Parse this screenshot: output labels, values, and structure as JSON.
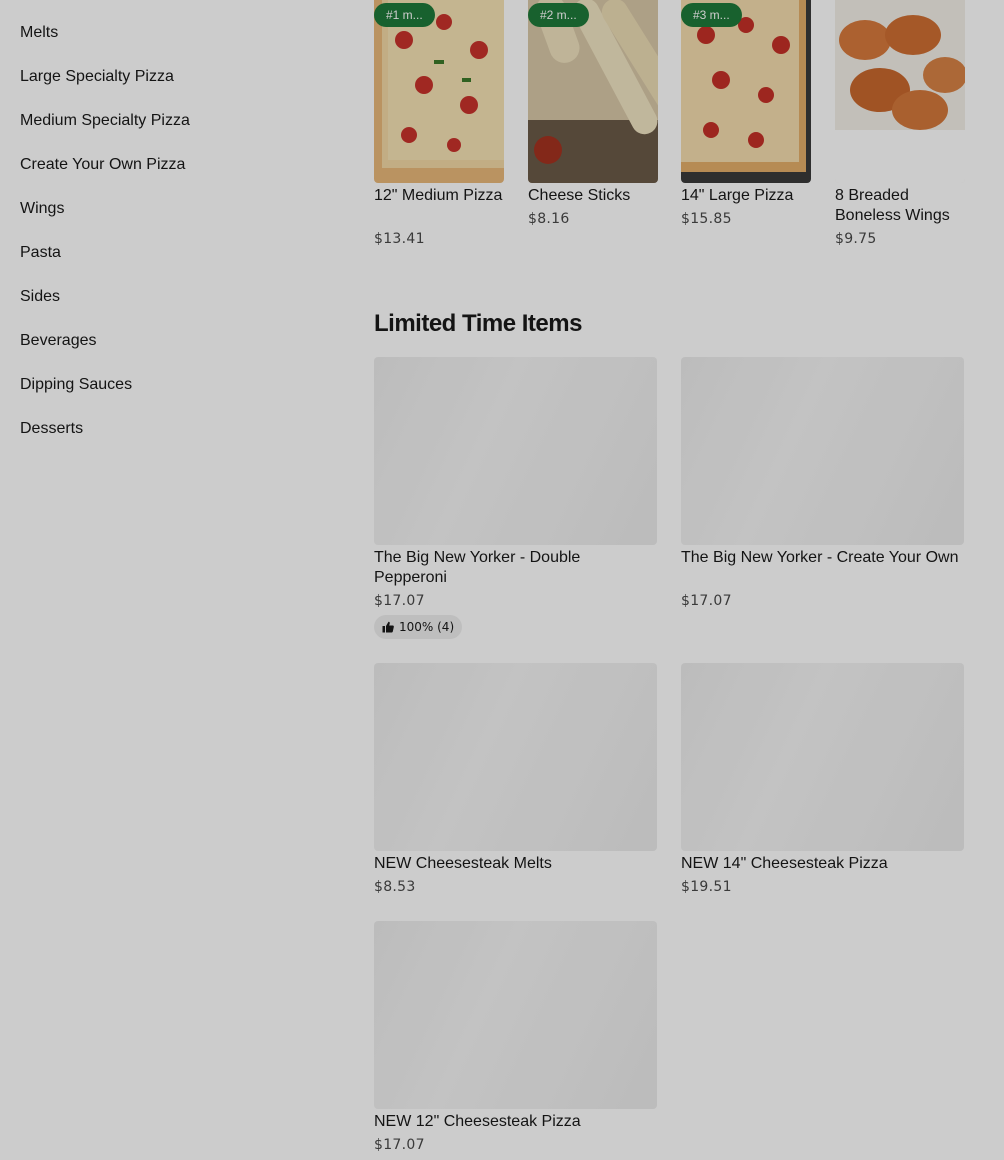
{
  "sidebar": {
    "items": [
      {
        "label": "Melts"
      },
      {
        "label": "Large Specialty Pizza"
      },
      {
        "label": "Medium Specialty Pizza"
      },
      {
        "label": "Create Your Own Pizza"
      },
      {
        "label": "Wings"
      },
      {
        "label": "Pasta"
      },
      {
        "label": "Sides"
      },
      {
        "label": "Beverages"
      },
      {
        "label": "Dipping Sauces"
      },
      {
        "label": "Desserts"
      }
    ]
  },
  "popular": {
    "items": [
      {
        "badge": "#1 m...",
        "name": "12\" Medium Pizza",
        "price": "$13.41"
      },
      {
        "badge": "#2 m...",
        "name": "Cheese Sticks",
        "price": "$8.16"
      },
      {
        "badge": "#3 m...",
        "name": "14\" Large Pizza",
        "price": "$15.85"
      },
      {
        "badge": "",
        "name": "8 Breaded Boneless Wings",
        "price": "$9.75"
      }
    ]
  },
  "limited": {
    "title": "Limited Time Items",
    "items": [
      {
        "name": "The Big New Yorker - Double Pepperoni",
        "price": "$17.07",
        "rating": "100% (4)"
      },
      {
        "name": "The Big New Yorker - Create Your Own",
        "price": "$17.07"
      },
      {
        "name": "NEW Cheesesteak Melts",
        "price": "$8.53"
      },
      {
        "name": "NEW 14\" Cheesesteak Pizza",
        "price": "$19.51"
      },
      {
        "name": "NEW 12\" Cheesesteak Pizza",
        "price": "$17.07"
      }
    ]
  },
  "colors": {
    "badge_green": "#1f7a3a",
    "overlay": "rgba(0,0,0,0.2)"
  }
}
